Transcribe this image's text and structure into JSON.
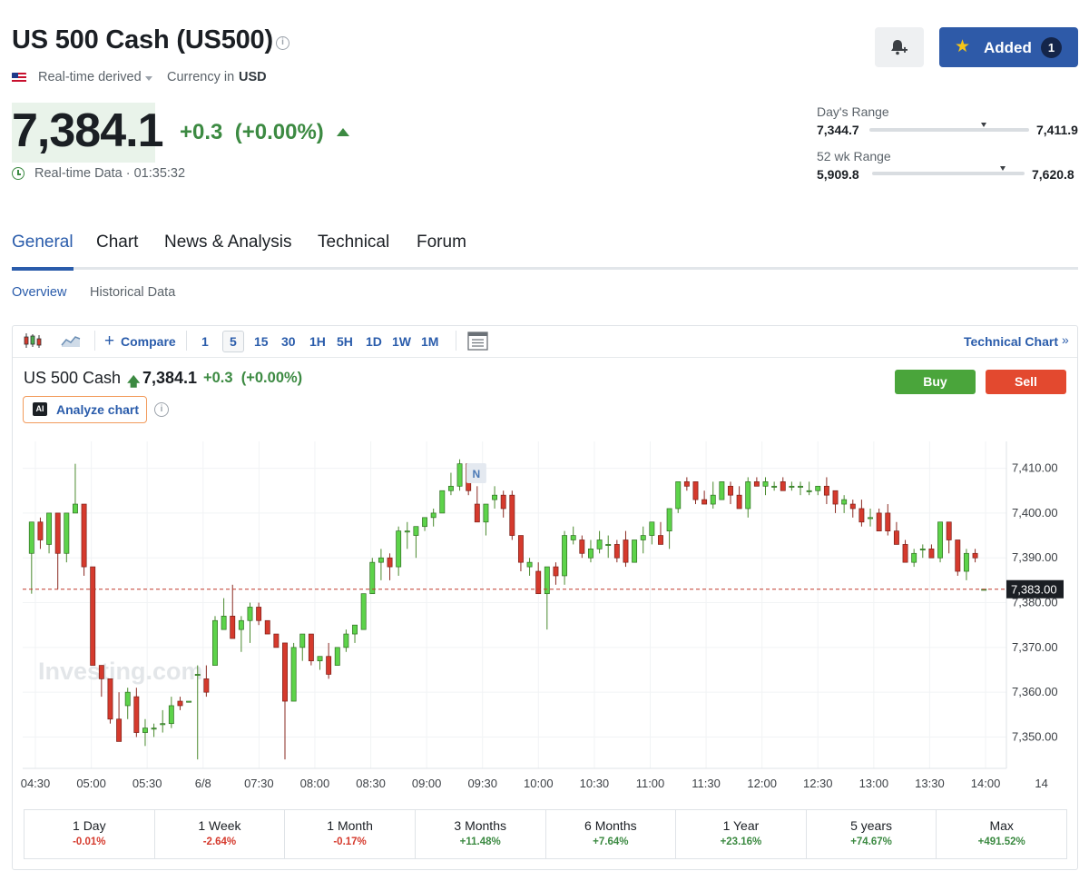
{
  "header": {
    "title": "US 500 Cash (US500)",
    "data_source": "Real-time derived",
    "currency_label": "Currency in",
    "currency": "USD",
    "price": "7,384.1",
    "change": "+0.3",
    "change_pct": "(+0.00%)",
    "realtime_label": "Real-time Data",
    "realtime_time": "· 01:35:32",
    "added_label": "Added",
    "added_count": "1",
    "colors": {
      "up": "#3c8a42",
      "down": "#d53a2d",
      "accent": "#2a5cab",
      "added_bg": "#2e5aa8"
    }
  },
  "ranges": {
    "day": {
      "label": "Day's Range",
      "low": "7,344.7",
      "high": "7,411.9",
      "position": 0.72
    },
    "week52": {
      "label": "52 wk Range",
      "low": "5,909.8",
      "high": "7,620.8",
      "position": 0.86
    }
  },
  "tabs": [
    {
      "label": "General",
      "active": true
    },
    {
      "label": "Chart",
      "active": false
    },
    {
      "label": "News & Analysis",
      "active": false
    },
    {
      "label": "Technical",
      "active": false
    },
    {
      "label": "Forum",
      "active": false
    }
  ],
  "subtabs": [
    {
      "label": "Overview",
      "active": true
    },
    {
      "label": "Historical Data",
      "active": false
    }
  ],
  "toolbar": {
    "compare_label": "Compare",
    "intervals": [
      "1",
      "5",
      "15",
      "30",
      "1H",
      "5H",
      "1D",
      "1W",
      "1M"
    ],
    "active_interval": "5",
    "technical_label": "Technical Chart",
    "icons": [
      "candlestick-icon",
      "area-chart-icon",
      "plus-icon",
      "layout-icon",
      "chevron-right-icon"
    ]
  },
  "instrument": {
    "name": "US 500 Cash",
    "price": "7,384.1",
    "change": "+0.3",
    "change_pct": "(+0.00%)",
    "buy_label": "Buy",
    "sell_label": "Sell",
    "analyze_label": "Analyze chart",
    "ai_badge": "AI"
  },
  "chart_data": {
    "type": "candlestick",
    "watermark": "Investing.com",
    "news_marker": "N",
    "current_price_label": "7,383.00",
    "current_price": 7383.0,
    "y_ticks": [
      7410,
      7400,
      7390,
      7380,
      7370,
      7360,
      7350
    ],
    "y_tick_labels": [
      "7,410.00",
      "7,400.00",
      "7,390.00",
      "7,380.00",
      "7,370.00",
      "7,360.00",
      "7,350.00"
    ],
    "ylim": [
      7343.0,
      7416.0
    ],
    "x_tick_labels": [
      "04:30",
      "05:00",
      "05:30",
      "6/8",
      "07:30",
      "08:00",
      "08:30",
      "09:00",
      "09:30",
      "10:00",
      "10:30",
      "11:00",
      "11:30",
      "12:00",
      "12:30",
      "13:00",
      "13:30",
      "14:00",
      "14"
    ],
    "candles": [
      [
        7391,
        7398,
        7382,
        7398
      ],
      [
        7398,
        7399,
        7392,
        7394
      ],
      [
        7393,
        7400,
        7391,
        7400
      ],
      [
        7400,
        7400,
        7383,
        7391
      ],
      [
        7391,
        7400,
        7389,
        7400
      ],
      [
        7400,
        7411,
        7400,
        7402
      ],
      [
        7402,
        7402,
        7386,
        7388
      ],
      [
        7388,
        7388,
        7366,
        7366
      ],
      [
        7366,
        7366,
        7359,
        7363
      ],
      [
        7363,
        7363,
        7353,
        7354
      ],
      [
        7354,
        7360,
        7350,
        7349
      ],
      [
        7357,
        7361,
        7354,
        7360
      ],
      [
        7359,
        7361,
        7350,
        7351
      ],
      [
        7351,
        7354,
        7348,
        7352
      ],
      [
        7352,
        7353,
        7350,
        7352
      ],
      [
        7353,
        7356,
        7351,
        7353
      ],
      [
        7353,
        7359,
        7352,
        7357
      ],
      [
        7358,
        7359,
        7356,
        7357
      ],
      [
        7358,
        7358,
        7358,
        7358
      ],
      [
        7364,
        7366,
        7345,
        7364
      ],
      [
        7363,
        7366,
        7359,
        7360
      ],
      [
        7366,
        7377,
        7366,
        7376
      ],
      [
        7374,
        7381,
        7374,
        7377
      ],
      [
        7377,
        7384,
        7374,
        7372
      ],
      [
        7374,
        7377,
        7369,
        7376
      ],
      [
        7376,
        7380,
        7371,
        7379
      ],
      [
        7379,
        7380,
        7375,
        7376
      ],
      [
        7376,
        7376,
        7374,
        7373
      ],
      [
        7373,
        7373,
        7372,
        7370
      ],
      [
        7371,
        7371,
        7345,
        7358
      ],
      [
        7358,
        7371,
        7358,
        7370
      ],
      [
        7370,
        7373,
        7367,
        7373
      ],
      [
        7373,
        7373,
        7366,
        7367
      ],
      [
        7367,
        7368,
        7365,
        7368
      ],
      [
        7368,
        7371,
        7363,
        7364
      ],
      [
        7366,
        7370,
        7366,
        7370
      ],
      [
        7370,
        7374,
        7369,
        7373
      ],
      [
        7373,
        7375,
        7371,
        7375
      ],
      [
        7374,
        7382,
        7374,
        7382
      ],
      [
        7382,
        7390,
        7382,
        7389
      ],
      [
        7389,
        7392,
        7385,
        7390
      ],
      [
        7390,
        7391,
        7385,
        7388
      ],
      [
        7388,
        7397,
        7386,
        7396
      ],
      [
        7396,
        7398,
        7392,
        7396
      ],
      [
        7395,
        7397,
        7390,
        7397
      ],
      [
        7397,
        7399,
        7396,
        7399
      ],
      [
        7399,
        7401,
        7397,
        7400
      ],
      [
        7400,
        7405,
        7400,
        7405
      ],
      [
        7405,
        7409,
        7404,
        7406
      ],
      [
        7406,
        7412,
        7405,
        7411
      ],
      [
        7411,
        7411,
        7404,
        7405
      ],
      [
        7402,
        7406,
        7400,
        7398
      ],
      [
        7398,
        7402,
        7395,
        7402
      ],
      [
        7403,
        7406,
        7401,
        7404
      ],
      [
        7404,
        7405,
        7399,
        7401
      ],
      [
        7404,
        7405,
        7394,
        7395
      ],
      [
        7395,
        7395,
        7387,
        7389
      ],
      [
        7388,
        7390,
        7386,
        7389
      ],
      [
        7387,
        7389,
        7382,
        7382
      ],
      [
        7382,
        7387,
        7374,
        7388
      ],
      [
        7388,
        7389,
        7384,
        7386
      ],
      [
        7386,
        7396,
        7384,
        7395
      ],
      [
        7394,
        7397,
        7393,
        7395
      ],
      [
        7394,
        7395,
        7390,
        7391
      ],
      [
        7390,
        7394,
        7389,
        7392
      ],
      [
        7392,
        7396,
        7391,
        7394
      ],
      [
        7393,
        7395,
        7390,
        7393
      ],
      [
        7393,
        7394,
        7389,
        7390
      ],
      [
        7394,
        7396,
        7388,
        7389
      ],
      [
        7389,
        7394,
        7389,
        7394
      ],
      [
        7394,
        7397,
        7391,
        7395
      ],
      [
        7395,
        7398,
        7393,
        7398
      ],
      [
        7395,
        7398,
        7393,
        7393
      ],
      [
        7396,
        7399,
        7392,
        7401
      ],
      [
        7401,
        7407,
        7400,
        7407
      ],
      [
        7407,
        7408,
        7405,
        7406
      ],
      [
        7407,
        7407,
        7402,
        7403
      ],
      [
        7403,
        7405,
        7402,
        7402
      ],
      [
        7402,
        7407,
        7401,
        7404
      ],
      [
        7403,
        7407,
        7403,
        7407
      ],
      [
        7406,
        7407,
        7402,
        7404
      ],
      [
        7404,
        7406,
        7402,
        7401
      ],
      [
        7401,
        7408,
        7399,
        7407
      ],
      [
        7407,
        7408,
        7406,
        7406
      ],
      [
        7406,
        7408,
        7404,
        7407
      ],
      [
        7406,
        7407,
        7405,
        7406
      ],
      [
        7407,
        7408,
        7405,
        7405
      ],
      [
        7406,
        7407,
        7405,
        7406
      ],
      [
        7406,
        7407,
        7404,
        7406
      ],
      [
        7405,
        7407,
        7404,
        7405
      ],
      [
        7405,
        7406,
        7404,
        7406
      ],
      [
        7406,
        7408,
        7402,
        7404
      ],
      [
        7405,
        7405,
        7400,
        7402
      ],
      [
        7402,
        7404,
        7400,
        7403
      ],
      [
        7402,
        7403,
        7399,
        7401
      ],
      [
        7401,
        7403,
        7397,
        7398
      ],
      [
        7399,
        7401,
        7397,
        7399
      ],
      [
        7400,
        7401,
        7396,
        7396
      ],
      [
        7400,
        7402,
        7395,
        7396
      ],
      [
        7396,
        7398,
        7393,
        7393
      ],
      [
        7393,
        7394,
        7389,
        7389
      ],
      [
        7389,
        7392,
        7388,
        7391
      ],
      [
        7392,
        7393,
        7390,
        7392
      ],
      [
        7392,
        7393,
        7390,
        7390
      ],
      [
        7390,
        7398,
        7389,
        7398
      ],
      [
        7398,
        7398,
        7391,
        7394
      ],
      [
        7394,
        7394,
        7386,
        7387
      ],
      [
        7387,
        7392,
        7385,
        7391
      ],
      [
        7391,
        7392,
        7389,
        7390
      ],
      [
        7383,
        7383,
        7383,
        7383
      ]
    ]
  },
  "performance": [
    {
      "label": "1 Day",
      "value": "-0.01%",
      "direction": "down"
    },
    {
      "label": "1 Week",
      "value": "-2.64%",
      "direction": "down"
    },
    {
      "label": "1 Month",
      "value": "-0.17%",
      "direction": "down"
    },
    {
      "label": "3 Months",
      "value": "+11.48%",
      "direction": "up"
    },
    {
      "label": "6 Months",
      "value": "+7.64%",
      "direction": "up"
    },
    {
      "label": "1 Year",
      "value": "+23.16%",
      "direction": "up"
    },
    {
      "label": "5 years",
      "value": "+74.67%",
      "direction": "up"
    },
    {
      "label": "Max",
      "value": "+491.52%",
      "direction": "up"
    }
  ]
}
